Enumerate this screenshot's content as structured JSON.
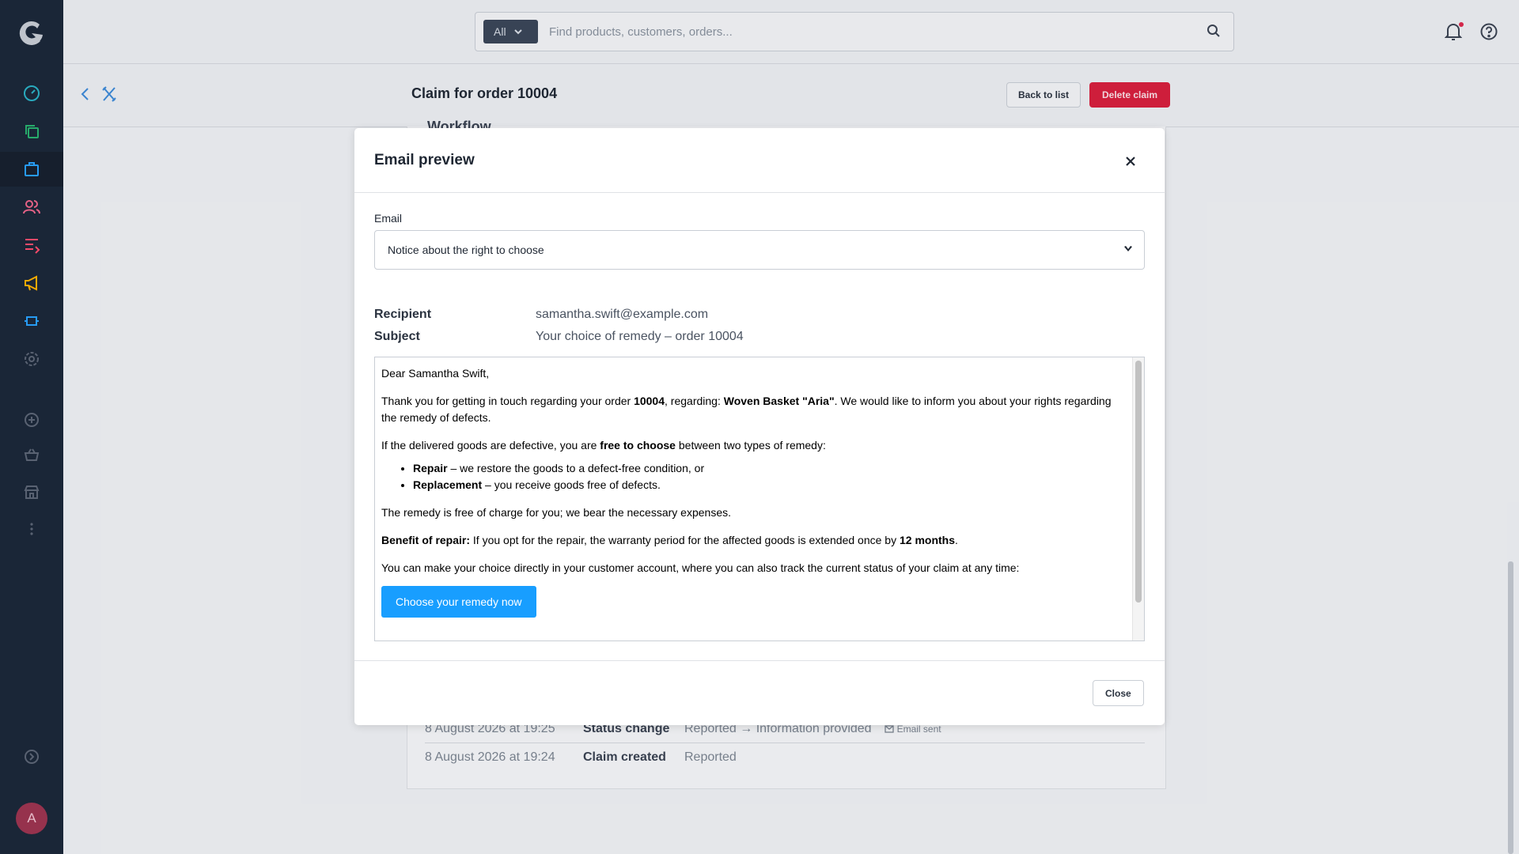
{
  "search": {
    "scope": "All",
    "placeholder": "Find products, customers, orders..."
  },
  "page": {
    "title": "Claim for order 10004",
    "back_to_list": "Back to list",
    "delete_claim": "Delete claim",
    "partial_heading": "Workflow"
  },
  "user": {
    "avatar_initial": "A"
  },
  "history": [
    {
      "date": "8 August 2026 at 19:25",
      "event": "Status change",
      "detail": "Reported → Information provided",
      "note": "Email sent"
    },
    {
      "date": "8 August 2026 at 19:24",
      "event": "Claim created",
      "detail": "Reported"
    }
  ],
  "modal": {
    "title": "Email preview",
    "email_label": "Email",
    "email_selected": "Notice about the right to choose",
    "recipient_label": "Recipient",
    "recipient_value": "samantha.swift@example.com",
    "subject_label": "Subject",
    "subject_value": "Your choice of remedy – order 10004",
    "close_label": "Close"
  },
  "email": {
    "greeting": "Dear Samantha Swift,",
    "p1_a": "Thank you for getting in touch regarding your order ",
    "p1_order": "10004",
    "p1_b": ", regarding: ",
    "p1_product": "Woven Basket \"Aria\"",
    "p1_c": ". We would like to inform you about your rights regarding the remedy of defects.",
    "p2_a": "If the delivered goods are defective, you are ",
    "p2_bold": "free to choose",
    "p2_b": " between two types of remedy:",
    "li1_bold": "Repair",
    "li1_text": " – we restore the goods to a defect-free condition, or",
    "li2_bold": "Replacement",
    "li2_text": " – you receive goods free of defects.",
    "p3": "The remedy is free of charge for you; we bear the necessary expenses.",
    "p4_bold": "Benefit of repair:",
    "p4_a": " If you opt for the repair, the warranty period for the affected goods is extended once by ",
    "p4_months": "12 months",
    "p4_b": ".",
    "p5": "You can make your choice directly in your customer account, where you can also track the current status of your claim at any time:",
    "cta": "Choose your remedy now"
  },
  "colors": {
    "sidebar": "#1b2738",
    "accent": "#189eff",
    "danger": "#d91f3d"
  }
}
